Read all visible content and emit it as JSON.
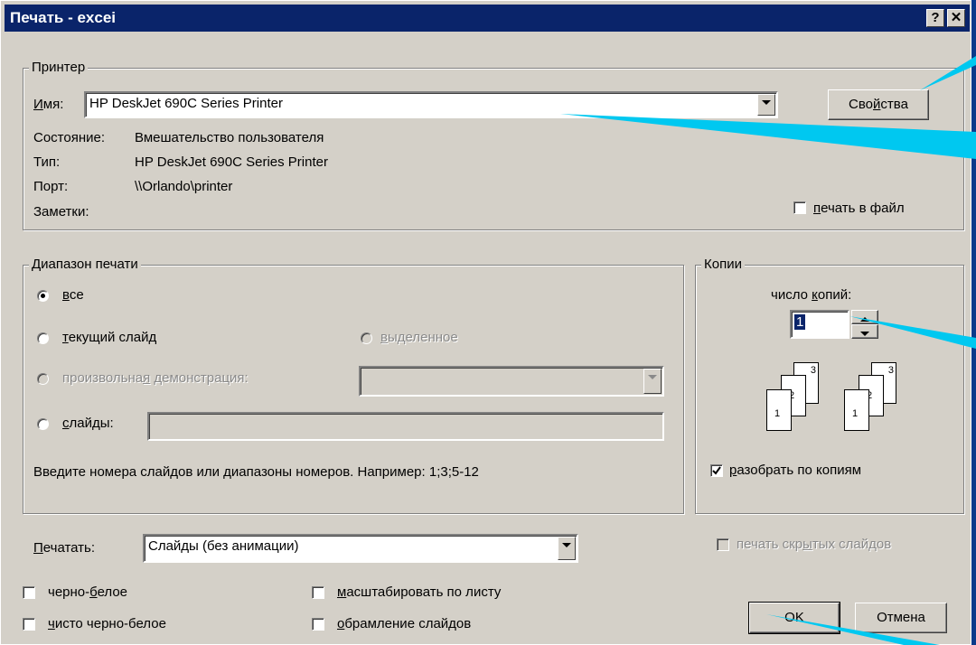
{
  "window": {
    "title": "Печать - excei",
    "help_label": "?",
    "close_label": "✕"
  },
  "printer": {
    "legend": "Принтер",
    "name_label": "Имя:",
    "name_value": "HP DeskJet 690C Series Printer",
    "properties_button": "Свойства",
    "status_label": "Состояние:",
    "status_value": "Вмешательство пользователя",
    "type_label": "Тип:",
    "type_value": "HP DeskJet 690C Series Printer",
    "port_label": "Порт:",
    "port_value": "\\\\Orlando\\printer",
    "notes_label": "Заметки:",
    "print_to_file_label": "печать в файл",
    "print_to_file_checked": false
  },
  "range": {
    "legend": "Диапазон печати",
    "all_label": "все",
    "current_slide_label": "текущий слайд",
    "selection_label": "выделенное",
    "custom_show_label": "произвольная демонстрация:",
    "slides_label": "слайды:",
    "slides_value": "",
    "hint": "Введите номера слайдов или диапазоны номеров. Например: 1;3;5-12",
    "selected": "all"
  },
  "copies": {
    "legend": "Копии",
    "count_label": "число копий:",
    "count_value": "1",
    "collate_label": "разобрать по копиям",
    "collate_checked": true,
    "page_numbers": [
      "1",
      "2",
      "3"
    ]
  },
  "print_what": {
    "label": "Печатать:",
    "value": "Слайды (без анимации)"
  },
  "options": {
    "print_hidden_label": "печать скрытых слайдов",
    "bw_label": "черно-белое",
    "pure_bw_label": "чисто черно-белое",
    "scale_label": "масштабировать по листу",
    "frame_label": "обрамление слайдов"
  },
  "buttons": {
    "ok": "OK",
    "cancel": "Отмена"
  },
  "colors": {
    "background": "#0b3a8a",
    "dialog": "#d4d0c8",
    "titlebar": "#0a246a",
    "callout": "#00c8f0"
  }
}
